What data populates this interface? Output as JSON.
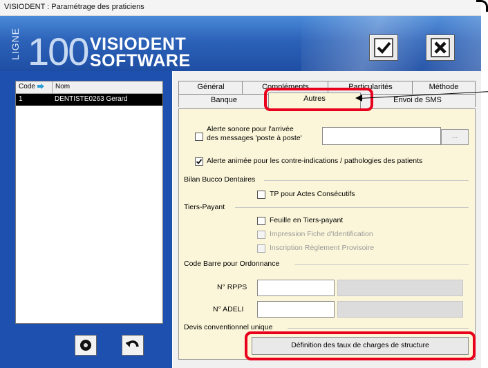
{
  "window": {
    "title": "VISIODENT : Paramétrage des praticiens"
  },
  "banner": {
    "ligne": "LIGNE",
    "number": "100",
    "brand_line1": "VISIODENT",
    "brand_line2": "SOFTWARE",
    "ok_icon": "check-icon",
    "close_icon": "close-x-icon"
  },
  "list": {
    "columns": [
      "Code",
      "Nom"
    ],
    "rows": [
      {
        "code": "1",
        "name": "DENTISTE0263 Gerard"
      }
    ]
  },
  "tabs": {
    "row1": [
      "Général",
      "Compléments",
      "Particularités",
      "Méthode"
    ],
    "row2": [
      "Banque",
      "Autres",
      "Envoi de SMS"
    ],
    "active": "Autres"
  },
  "form": {
    "alerte_sonore_line1": "Alerte sonore pour l'arrivée",
    "alerte_sonore_line2": "des messages 'poste à poste'",
    "browse_label": "...",
    "alerte_animee": "Alerte animée pour les contre-indications / pathologies des patients",
    "bilan_group": "Bilan Bucco Dentaires",
    "tp_actes": "TP pour Actes Consécutifs",
    "tiers_group": "Tiers-Payant",
    "feuille_tp": "Feuille en Tiers-payant",
    "impression_fiche": "Impression Fiche d'Identification",
    "inscription_reglement": "Inscription Règlement Provisoire",
    "code_barre_group": "Code Barre pour Ordonnance",
    "rpps_label": "N° RPPS",
    "adeli_label": "N° ADELI",
    "devis_group": "Devis conventionnel unique",
    "definition_button": "Définition des taux de charges de structure",
    "alerte_animee_checked": true
  },
  "colors": {
    "banner": "#2c62b8",
    "panel": "#fbf6d9",
    "highlight": "#e8001c",
    "left_pane": "#1e50b0"
  }
}
